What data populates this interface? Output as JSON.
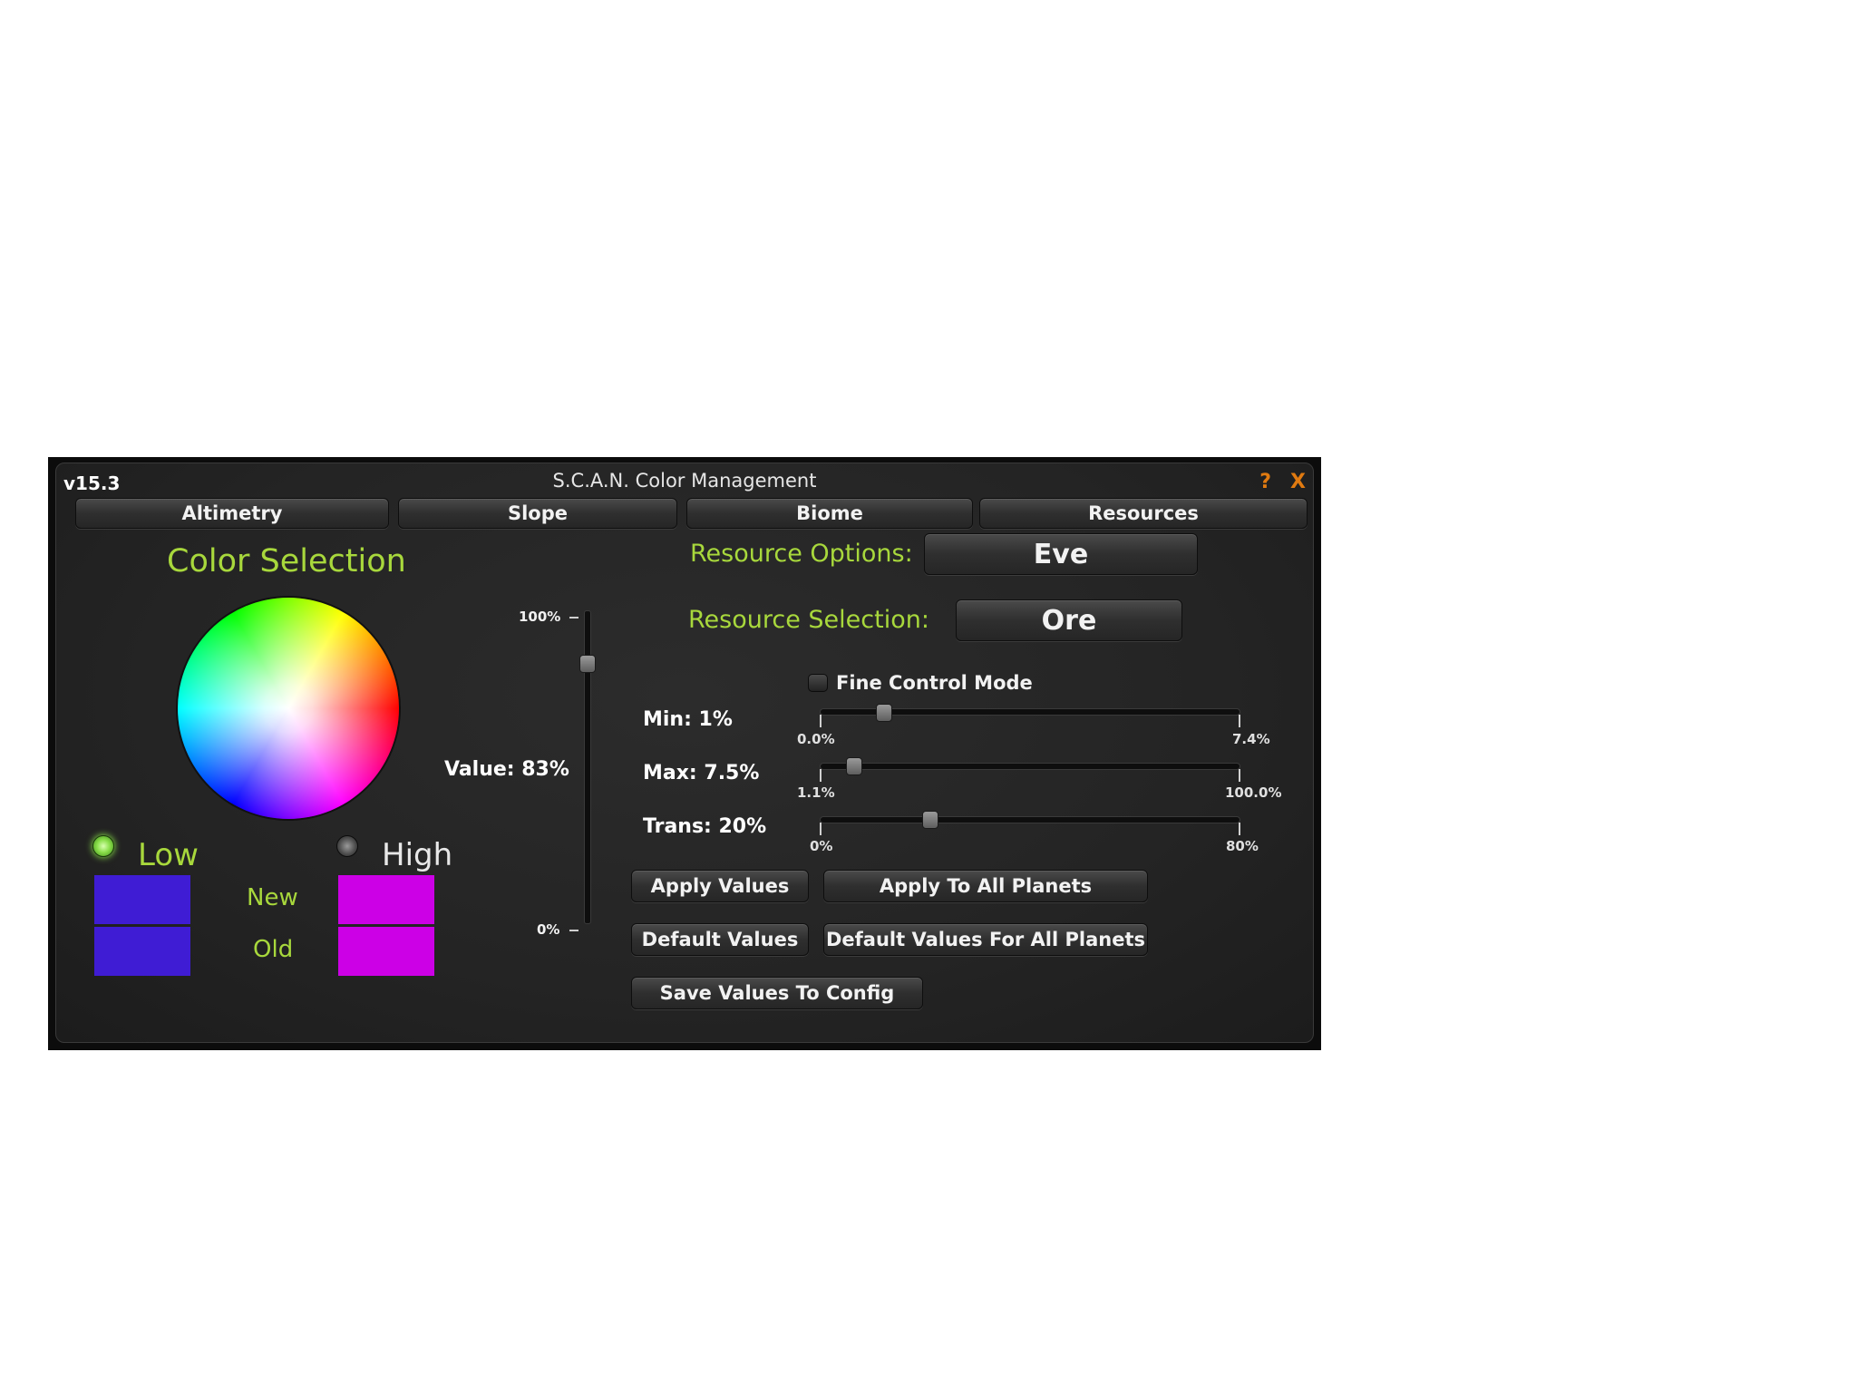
{
  "window": {
    "version": "v15.3",
    "title": "S.C.A.N. Color Management",
    "help_label": "?",
    "close_label": "X"
  },
  "tabs": [
    "Altimetry",
    "Slope",
    "Biome",
    "Resources"
  ],
  "color_selection": {
    "heading": "Color Selection",
    "value_label": "Value: 83%",
    "value_level": 0.83,
    "value_max_label": "100%",
    "value_min_label": "0%",
    "low_label": "Low",
    "high_label": "High",
    "new_label": "New",
    "old_label": "Old",
    "selected": "Low",
    "low_new_color": "#3f1cd4",
    "low_old_color": "#3f1cd4",
    "high_new_color": "#cc00e6",
    "high_old_color": "#cc00e6",
    "accent_color": "#a8d83c"
  },
  "resource_options": {
    "label": "Resource Options:",
    "value": "Eve"
  },
  "resource_selection": {
    "label": "Resource Selection:",
    "value": "Ore"
  },
  "fine_control": {
    "label": "Fine Control Mode",
    "checked": false
  },
  "sliders": {
    "min": {
      "label": "Min: 1%",
      "low": "0.0%",
      "high": "7.4%",
      "level": 0.15
    },
    "max": {
      "label": "Max: 7.5%",
      "low": "1.1%",
      "high": "100.0%",
      "level": 0.08
    },
    "trans": {
      "label": "Trans: 20%",
      "low": "0%",
      "high": "80%",
      "level": 0.26
    }
  },
  "buttons": {
    "apply": "Apply Values",
    "apply_all": "Apply To All Planets",
    "default": "Default Values",
    "default_all": "Default Values For All Planets",
    "save": "Save Values To Config"
  }
}
